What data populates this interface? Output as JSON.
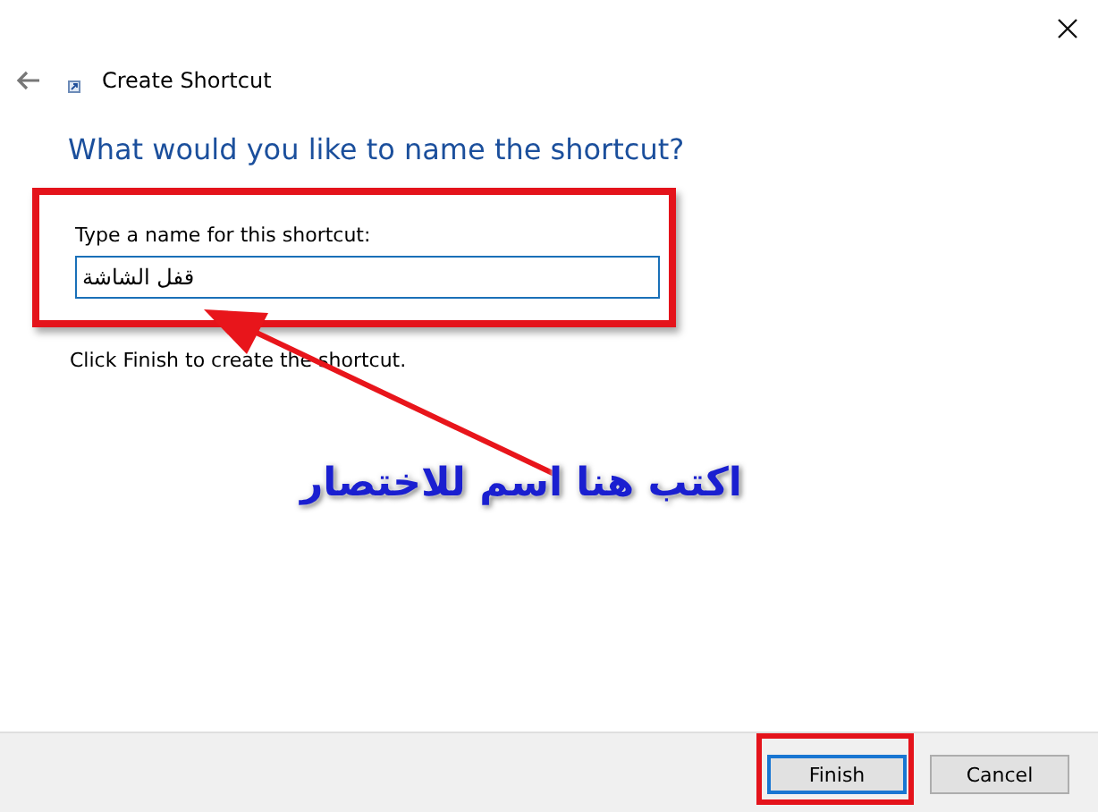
{
  "window": {
    "title": "Create Shortcut"
  },
  "heading": "What would you like to name the shortcut?",
  "name_field": {
    "label": "Type a name for this shortcut:",
    "value": "قفل الشاشة",
    "highlighted": true
  },
  "instruction": "Click Finish to create the shortcut.",
  "annotation": {
    "text": "اكتب هنا اسم للاختصار"
  },
  "buttons": [
    {
      "label": "Finish",
      "default": true,
      "highlighted": true
    },
    {
      "label": "Cancel",
      "default": false,
      "highlighted": false
    }
  ]
}
